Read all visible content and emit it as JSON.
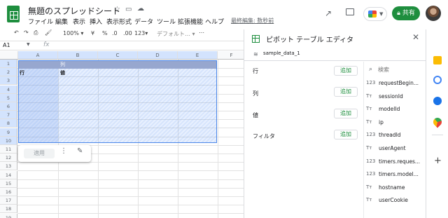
{
  "header": {
    "title": "無題のスプレッドシート",
    "menu": [
      "ファイル",
      "編集",
      "表示",
      "挿入",
      "表示形式",
      "データ",
      "ツール",
      "拡張機能",
      "ヘルプ"
    ],
    "last_edit": "最終編集: 数秒前",
    "share_label": "共有"
  },
  "toolbar": {
    "zoom": "100%",
    "currency": "¥",
    "percent": "%",
    "dec_decrease": ".0",
    "dec_increase": ".00",
    "number_format": "123",
    "font": "デフォルト…",
    "more": "⋯"
  },
  "formula_bar": {
    "cell_ref": "A1",
    "fx": "fx"
  },
  "grid": {
    "columns": [
      "A",
      "B",
      "C",
      "D",
      "E",
      "F"
    ],
    "rows": [
      "1",
      "2",
      "3",
      "4",
      "5",
      "6",
      "7",
      "8",
      "9",
      "10",
      "11",
      "12",
      "13",
      "14",
      "15",
      "16",
      "17",
      "18",
      "19"
    ],
    "pivot_col_label": "列",
    "pivot_row_label": "行",
    "pivot_value_label": "値",
    "apply_label": "適用"
  },
  "pivot_editor": {
    "title": "ピボット テーブル エディタ",
    "source": "sample_data_1",
    "sections": [
      {
        "label": "行",
        "add": "追加"
      },
      {
        "label": "列",
        "add": "追加"
      },
      {
        "label": "値",
        "add": "追加"
      },
      {
        "label": "フィルタ",
        "add": "追加"
      }
    ],
    "search_placeholder": "検索",
    "fields": [
      {
        "type": "123",
        "name": "requestBegin..."
      },
      {
        "type": "Tт",
        "name": "sessionId"
      },
      {
        "type": "Tт",
        "name": "modelId"
      },
      {
        "type": "Tт",
        "name": "ip"
      },
      {
        "type": "123",
        "name": "threadId"
      },
      {
        "type": "Tт",
        "name": "userAgent"
      },
      {
        "type": "123",
        "name": "timers.reques..."
      },
      {
        "type": "123",
        "name": "timers.model..."
      },
      {
        "type": "Tт",
        "name": "hostname"
      },
      {
        "type": "Tт",
        "name": "userCookie"
      }
    ]
  },
  "colors": {
    "accent": "#1e8e3e",
    "selection": "#4a86e8"
  }
}
